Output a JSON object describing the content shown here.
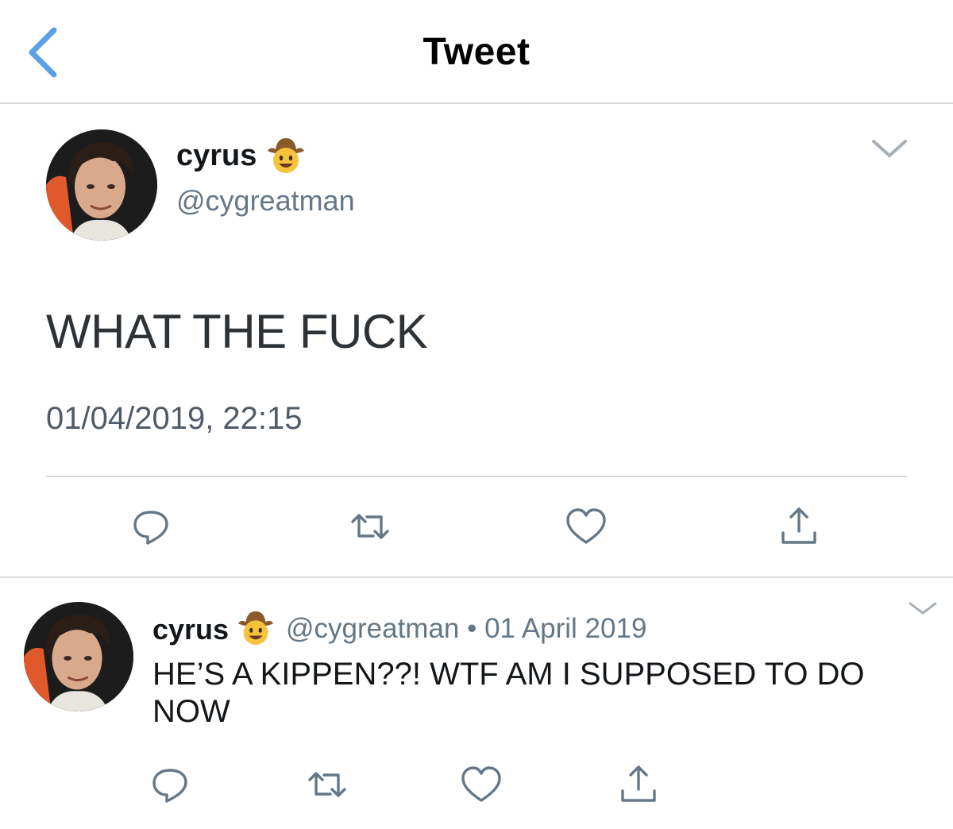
{
  "header": {
    "title": "Tweet",
    "back_icon": "chevron-left-icon",
    "accent": "#5aa1e4"
  },
  "main_tweet": {
    "name": "cyrus",
    "name_emoji": "cowboy-face-emoji",
    "handle": "@cygreatman",
    "text": "WHAT THE FUCK",
    "timestamp": "01/04/2019, 22:15",
    "menu_icon": "chevron-down-icon",
    "actions": [
      "reply-icon",
      "retweet-icon",
      "like-icon",
      "share-icon"
    ]
  },
  "reply_tweet": {
    "name": "cyrus",
    "name_emoji": "cowboy-face-emoji",
    "meta": "@cygreatman • 01 April 2019",
    "text": "HE’S A KIPPEN??! WTF AM I SUPPOSED TO DO NOW",
    "menu_icon": "chevron-down-icon",
    "actions": [
      "reply-icon",
      "retweet-icon",
      "like-icon",
      "share-icon"
    ]
  },
  "colors": {
    "text_primary": "#14171a",
    "text_secondary": "#657786",
    "divider": "#d6d9dc",
    "icon": "#657786"
  }
}
